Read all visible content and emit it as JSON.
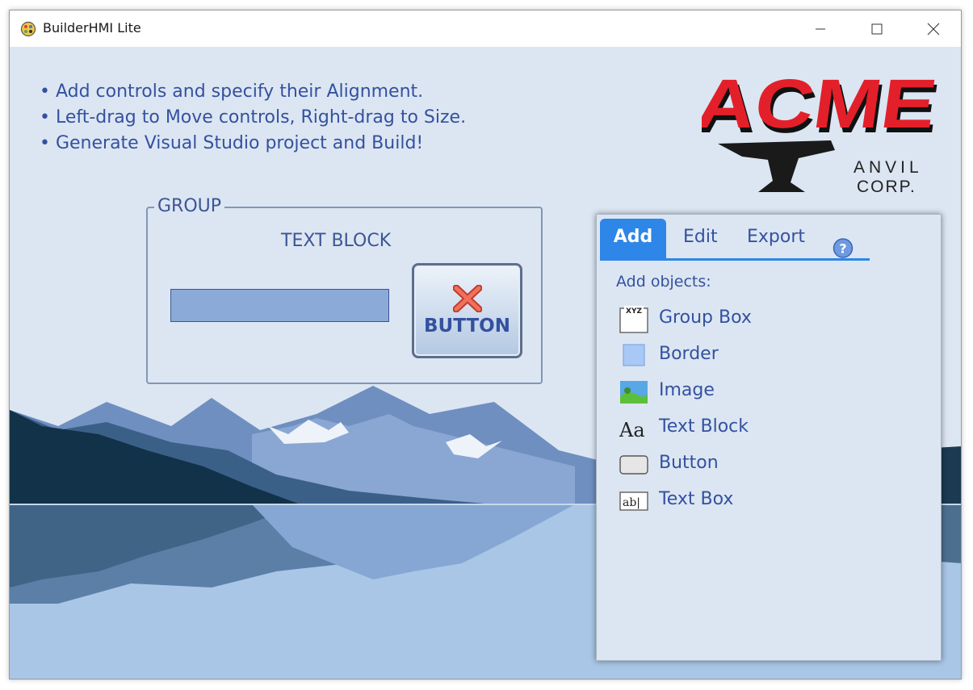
{
  "window": {
    "title": "BuilderHMI Lite"
  },
  "instructions": [
    "• Add controls and specify their Alignment.",
    "• Left-drag to Move controls, Right-drag to Size.",
    "• Generate Visual Studio project and Build!"
  ],
  "logo": {
    "main": "ACME",
    "line1": "ANVIL",
    "line2": "CORP."
  },
  "design": {
    "group_header": "GROUP",
    "text_block": "TEXT BLOCK",
    "button_label": "BUTTON"
  },
  "panel": {
    "tabs": {
      "add": "Add",
      "edit": "Edit",
      "export": "Export"
    },
    "caption": "Add objects:",
    "objects": {
      "group_box": "Group Box",
      "border": "Border",
      "image": "Image",
      "text_block": "Text Block",
      "button": "Button",
      "text_box": "Text Box"
    },
    "icon_text": {
      "group_box": "XYZ",
      "text_block": "Aa",
      "text_box": "ab|"
    }
  },
  "colors": {
    "accent": "#2e86e8",
    "text": "#3451a0",
    "logo_red": "#e3202a"
  }
}
